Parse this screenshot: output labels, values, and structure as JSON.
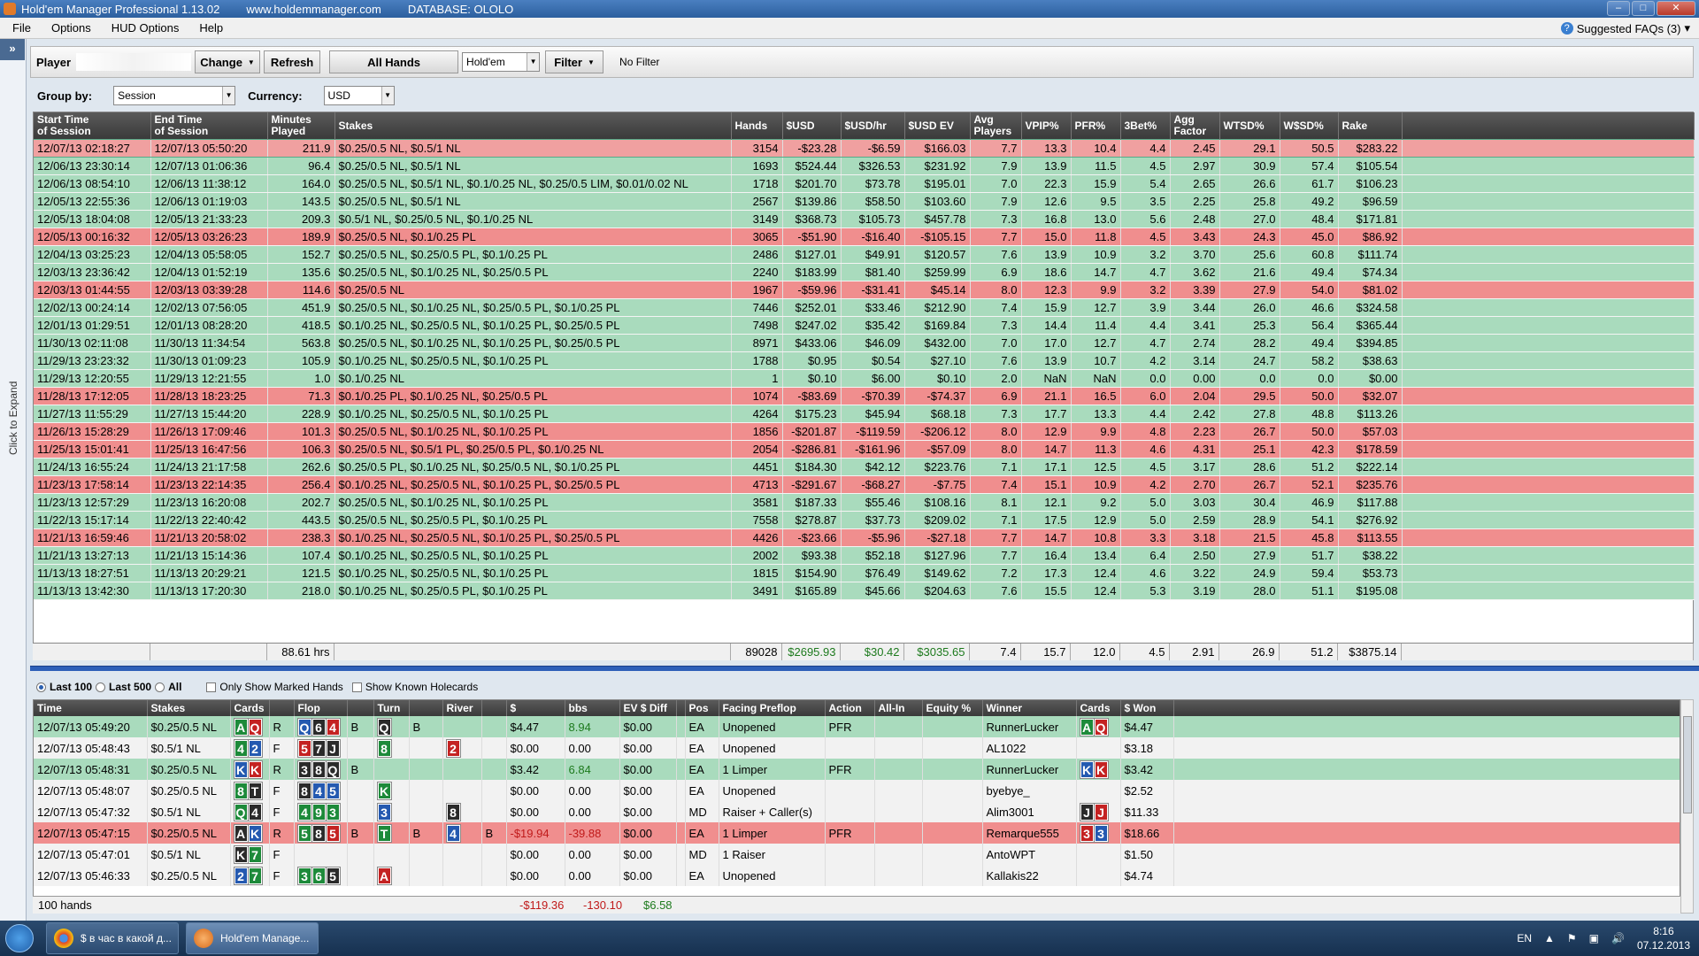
{
  "window": {
    "title": "Hold'em Manager Professional 1.13.02",
    "url": "www.holdemmanager.com",
    "database": "DATABASE: OLOLO"
  },
  "menu": {
    "items": [
      "File",
      "Options",
      "HUD Options",
      "Help"
    ],
    "faq": "Suggested FAQs (3)"
  },
  "sidebar": {
    "expand_label": "Click to Expand",
    "expand_glyph": "»"
  },
  "filterbar": {
    "player_label": "Player",
    "change": "Change",
    "refresh": "Refresh",
    "all_hands": "All Hands",
    "game": "Hold'em",
    "filter": "Filter",
    "no_filter": "No Filter"
  },
  "groupbar": {
    "group_label": "Group by:",
    "group_value": "Session",
    "currency_label": "Currency:",
    "currency_value": "USD"
  },
  "sessions": {
    "columns": [
      "Start Time\nof Session",
      "End Time\nof Session",
      "Minutes\nPlayed",
      "Stakes",
      "Hands",
      "$USD",
      "$USD/hr",
      "$USD EV",
      "Avg\nPlayers",
      "VPIP%",
      "PFR%",
      "3Bet%",
      "Agg\nFactor",
      "WTSD%",
      "W$SD%",
      "Rake"
    ],
    "rows": [
      [
        "12/07/13 02:18:27",
        "12/07/13 05:50:20",
        "211.9",
        "$0.25/0.5 NL, $0.5/1 NL",
        "3154",
        "-$23.28",
        "-$6.59",
        "$166.03",
        "7.7",
        "13.3",
        "10.4",
        "4.4",
        "2.45",
        "29.1",
        "50.5",
        "$283.22",
        "first"
      ],
      [
        "12/06/13 23:30:14",
        "12/07/13 01:06:36",
        "96.4",
        "$0.25/0.5 NL, $0.5/1 NL",
        "1693",
        "$524.44",
        "$326.53",
        "$231.92",
        "7.9",
        "13.9",
        "11.5",
        "4.5",
        "2.97",
        "30.9",
        "57.4",
        "$105.54",
        "win"
      ],
      [
        "12/06/13 08:54:10",
        "12/06/13 11:38:12",
        "164.0",
        "$0.25/0.5 NL, $0.5/1 NL, $0.1/0.25 NL, $0.25/0.5 LIM, $0.01/0.02 NL",
        "1718",
        "$201.70",
        "$73.78",
        "$195.01",
        "7.0",
        "22.3",
        "15.9",
        "5.4",
        "2.65",
        "26.6",
        "61.7",
        "$106.23",
        "win"
      ],
      [
        "12/05/13 22:55:36",
        "12/06/13 01:19:03",
        "143.5",
        "$0.25/0.5 NL, $0.5/1 NL",
        "2567",
        "$139.86",
        "$58.50",
        "$103.60",
        "7.9",
        "12.6",
        "9.5",
        "3.5",
        "2.25",
        "25.8",
        "49.2",
        "$96.59",
        "win"
      ],
      [
        "12/05/13 18:04:08",
        "12/05/13 21:33:23",
        "209.3",
        "$0.5/1 NL, $0.25/0.5 NL, $0.1/0.25 NL",
        "3149",
        "$368.73",
        "$105.73",
        "$457.78",
        "7.3",
        "16.8",
        "13.0",
        "5.6",
        "2.48",
        "27.0",
        "48.4",
        "$171.81",
        "win"
      ],
      [
        "12/05/13 00:16:32",
        "12/05/13 03:26:23",
        "189.9",
        "$0.25/0.5 NL, $0.1/0.25 PL",
        "3065",
        "-$51.90",
        "-$16.40",
        "-$105.15",
        "7.7",
        "15.0",
        "11.8",
        "4.5",
        "3.43",
        "24.3",
        "45.0",
        "$86.92",
        "loss"
      ],
      [
        "12/04/13 03:25:23",
        "12/04/13 05:58:05",
        "152.7",
        "$0.25/0.5 NL, $0.25/0.5 PL, $0.1/0.25 PL",
        "2486",
        "$127.01",
        "$49.91",
        "$120.57",
        "7.6",
        "13.9",
        "10.9",
        "3.2",
        "3.70",
        "25.6",
        "60.8",
        "$111.74",
        "win"
      ],
      [
        "12/03/13 23:36:42",
        "12/04/13 01:52:19",
        "135.6",
        "$0.25/0.5 NL, $0.1/0.25 NL, $0.25/0.5 PL",
        "2240",
        "$183.99",
        "$81.40",
        "$259.99",
        "6.9",
        "18.6",
        "14.7",
        "4.7",
        "3.62",
        "21.6",
        "49.4",
        "$74.34",
        "win"
      ],
      [
        "12/03/13 01:44:55",
        "12/03/13 03:39:28",
        "114.6",
        "$0.25/0.5 NL",
        "1967",
        "-$59.96",
        "-$31.41",
        "$45.14",
        "8.0",
        "12.3",
        "9.9",
        "3.2",
        "3.39",
        "27.9",
        "54.0",
        "$81.02",
        "loss"
      ],
      [
        "12/02/13 00:24:14",
        "12/02/13 07:56:05",
        "451.9",
        "$0.25/0.5 NL, $0.1/0.25 NL, $0.25/0.5 PL, $0.1/0.25 PL",
        "7446",
        "$252.01",
        "$33.46",
        "$212.90",
        "7.4",
        "15.9",
        "12.7",
        "3.9",
        "3.44",
        "26.0",
        "46.6",
        "$324.58",
        "win"
      ],
      [
        "12/01/13 01:29:51",
        "12/01/13 08:28:20",
        "418.5",
        "$0.1/0.25 NL, $0.25/0.5 NL, $0.1/0.25 PL, $0.25/0.5 PL",
        "7498",
        "$247.02",
        "$35.42",
        "$169.84",
        "7.3",
        "14.4",
        "11.4",
        "4.4",
        "3.41",
        "25.3",
        "56.4",
        "$365.44",
        "win"
      ],
      [
        "11/30/13 02:11:08",
        "11/30/13 11:34:54",
        "563.8",
        "$0.25/0.5 NL, $0.1/0.25 NL, $0.1/0.25 PL, $0.25/0.5 PL",
        "8971",
        "$433.06",
        "$46.09",
        "$432.00",
        "7.0",
        "17.0",
        "12.7",
        "4.7",
        "2.74",
        "28.2",
        "49.4",
        "$394.85",
        "win"
      ],
      [
        "11/29/13 23:23:32",
        "11/30/13 01:09:23",
        "105.9",
        "$0.1/0.25 NL, $0.25/0.5 NL, $0.1/0.25 PL",
        "1788",
        "$0.95",
        "$0.54",
        "$27.10",
        "7.6",
        "13.9",
        "10.7",
        "4.2",
        "3.14",
        "24.7",
        "58.2",
        "$38.63",
        "win"
      ],
      [
        "11/29/13 12:20:55",
        "11/29/13 12:21:55",
        "1.0",
        "$0.1/0.25 NL",
        "1",
        "$0.10",
        "$6.00",
        "$0.10",
        "2.0",
        "NaN",
        "NaN",
        "0.0",
        "0.00",
        "0.0",
        "0.0",
        "$0.00",
        "win"
      ],
      [
        "11/28/13 17:12:05",
        "11/28/13 18:23:25",
        "71.3",
        "$0.1/0.25 PL, $0.1/0.25 NL, $0.25/0.5 PL",
        "1074",
        "-$83.69",
        "-$70.39",
        "-$74.37",
        "6.9",
        "21.1",
        "16.5",
        "6.0",
        "2.04",
        "29.5",
        "50.0",
        "$32.07",
        "loss"
      ],
      [
        "11/27/13 11:55:29",
        "11/27/13 15:44:20",
        "228.9",
        "$0.1/0.25 NL, $0.25/0.5 NL, $0.1/0.25 PL",
        "4264",
        "$175.23",
        "$45.94",
        "$68.18",
        "7.3",
        "17.7",
        "13.3",
        "4.4",
        "2.42",
        "27.8",
        "48.8",
        "$113.26",
        "win"
      ],
      [
        "11/26/13 15:28:29",
        "11/26/13 17:09:46",
        "101.3",
        "$0.25/0.5 NL, $0.1/0.25 NL, $0.1/0.25 PL",
        "1856",
        "-$201.87",
        "-$119.59",
        "-$206.12",
        "8.0",
        "12.9",
        "9.9",
        "4.8",
        "2.23",
        "26.7",
        "50.0",
        "$57.03",
        "loss"
      ],
      [
        "11/25/13 15:01:41",
        "11/25/13 16:47:56",
        "106.3",
        "$0.25/0.5 NL, $0.5/1 PL, $0.25/0.5 PL, $0.1/0.25 NL",
        "2054",
        "-$286.81",
        "-$161.96",
        "-$57.09",
        "8.0",
        "14.7",
        "11.3",
        "4.6",
        "4.31",
        "25.1",
        "42.3",
        "$178.59",
        "loss"
      ],
      [
        "11/24/13 16:55:24",
        "11/24/13 21:17:58",
        "262.6",
        "$0.25/0.5 PL, $0.1/0.25 NL, $0.25/0.5 NL, $0.1/0.25 PL",
        "4451",
        "$184.30",
        "$42.12",
        "$223.76",
        "7.1",
        "17.1",
        "12.5",
        "4.5",
        "3.17",
        "28.6",
        "51.2",
        "$222.14",
        "win"
      ],
      [
        "11/23/13 17:58:14",
        "11/23/13 22:14:35",
        "256.4",
        "$0.1/0.25 NL, $0.25/0.5 NL, $0.1/0.25 PL, $0.25/0.5 PL",
        "4713",
        "-$291.67",
        "-$68.27",
        "-$7.75",
        "7.4",
        "15.1",
        "10.9",
        "4.2",
        "2.70",
        "26.7",
        "52.1",
        "$235.76",
        "loss"
      ],
      [
        "11/23/13 12:57:29",
        "11/23/13 16:20:08",
        "202.7",
        "$0.25/0.5 NL, $0.1/0.25 NL, $0.1/0.25 PL",
        "3581",
        "$187.33",
        "$55.46",
        "$108.16",
        "8.1",
        "12.1",
        "9.2",
        "5.0",
        "3.03",
        "30.4",
        "46.9",
        "$117.88",
        "win"
      ],
      [
        "11/22/13 15:17:14",
        "11/22/13 22:40:42",
        "443.5",
        "$0.25/0.5 NL, $0.25/0.5 PL, $0.1/0.25 PL",
        "7558",
        "$278.87",
        "$37.73",
        "$209.02",
        "7.1",
        "17.5",
        "12.9",
        "5.0",
        "2.59",
        "28.9",
        "54.1",
        "$276.92",
        "win"
      ],
      [
        "11/21/13 16:59:46",
        "11/21/13 20:58:02",
        "238.3",
        "$0.1/0.25 NL, $0.25/0.5 NL, $0.1/0.25 PL, $0.25/0.5 PL",
        "4426",
        "-$23.66",
        "-$5.96",
        "-$27.18",
        "7.7",
        "14.7",
        "10.8",
        "3.3",
        "3.18",
        "21.5",
        "45.8",
        "$113.55",
        "loss"
      ],
      [
        "11/21/13 13:27:13",
        "11/21/13 15:14:36",
        "107.4",
        "$0.1/0.25 NL, $0.25/0.5 NL, $0.1/0.25 PL",
        "2002",
        "$93.38",
        "$52.18",
        "$127.96",
        "7.7",
        "16.4",
        "13.4",
        "6.4",
        "2.50",
        "27.9",
        "51.7",
        "$38.22",
        "win"
      ],
      [
        "11/13/13 18:27:51",
        "11/13/13 20:29:21",
        "121.5",
        "$0.1/0.25 NL, $0.25/0.5 NL, $0.1/0.25 PL",
        "1815",
        "$154.90",
        "$76.49",
        "$149.62",
        "7.2",
        "17.3",
        "12.4",
        "4.6",
        "3.22",
        "24.9",
        "59.4",
        "$53.73",
        "win"
      ],
      [
        "11/13/13 13:42:30",
        "11/13/13 17:20:30",
        "218.0",
        "$0.1/0.25 NL, $0.25/0.5 PL, $0.1/0.25 PL",
        "3491",
        "$165.89",
        "$45.66",
        "$204.63",
        "7.6",
        "15.5",
        "12.4",
        "5.3",
        "3.19",
        "28.0",
        "51.1",
        "$195.08",
        "win"
      ]
    ],
    "totals": [
      "",
      "",
      "88.61 hrs",
      "",
      "89028",
      "$2695.93",
      "$30.42",
      "$3035.65",
      "7.4",
      "15.7",
      "12.0",
      "4.5",
      "2.91",
      "26.9",
      "51.2",
      "$3875.14"
    ]
  },
  "hand_controls": {
    "last100": "Last 100",
    "last500": "Last 500",
    "all": "All",
    "only_marked": "Only Show Marked Hands",
    "show_known": "Show Known Holecards"
  },
  "hands": {
    "columns": [
      "Time",
      "Stakes",
      "Cards",
      "",
      "Flop",
      "",
      "Turn",
      "",
      "River",
      "",
      "$",
      "bbs",
      "EV $ Diff",
      "",
      "Pos",
      "Facing Preflop",
      "Action",
      "All-In",
      "Equity %",
      "Winner",
      "Cards",
      "$ Won"
    ],
    "rows": [
      {
        "style": "win",
        "time": "12/07/13 05:49:20",
        "stakes": "$0.25/0.5 NL",
        "cards": [
          [
            "A",
            "c"
          ],
          [
            "Q",
            "h"
          ]
        ],
        "pre": "R",
        "flop": [
          [
            "Q",
            "d"
          ],
          [
            "6",
            "s"
          ],
          [
            "4",
            "h"
          ]
        ],
        "flop_act": "B",
        "turn": [
          [
            "Q",
            "s"
          ]
        ],
        "turn_act": "B",
        "river": [],
        "river_act": "",
        "usd": "$4.47",
        "bbs": "8.94",
        "ev": "$0.00",
        "pos": "EA",
        "facing": "Unopened",
        "action": "PFR",
        "allin": "",
        "equity": "",
        "winner": "RunnerLucker",
        "wcards": [
          [
            "A",
            "c"
          ],
          [
            "Q",
            "h"
          ]
        ],
        "won": "$4.47"
      },
      {
        "style": "plain",
        "time": "12/07/13 05:48:43",
        "stakes": "$0.5/1 NL",
        "cards": [
          [
            "4",
            "c"
          ],
          [
            "2",
            "d"
          ]
        ],
        "pre": "F",
        "flop": [
          [
            "5",
            "h"
          ],
          [
            "7",
            "s"
          ],
          [
            "J",
            "s"
          ]
        ],
        "flop_act": "",
        "turn": [
          [
            "8",
            "c"
          ]
        ],
        "turn_act": "",
        "river": [
          [
            "2",
            "h"
          ]
        ],
        "river_act": "",
        "usd": "$0.00",
        "bbs": "0.00",
        "ev": "$0.00",
        "pos": "EA",
        "facing": "Unopened",
        "action": "",
        "allin": "",
        "equity": "",
        "winner": "AL1022",
        "wcards": [],
        "won": "$3.18"
      },
      {
        "style": "win",
        "time": "12/07/13 05:48:31",
        "stakes": "$0.25/0.5 NL",
        "cards": [
          [
            "K",
            "d"
          ],
          [
            "K",
            "h"
          ]
        ],
        "pre": "R",
        "flop": [
          [
            "3",
            "s"
          ],
          [
            "8",
            "s"
          ],
          [
            "Q",
            "s"
          ]
        ],
        "flop_act": "B",
        "turn": [],
        "turn_act": "",
        "river": [],
        "river_act": "",
        "usd": "$3.42",
        "bbs": "6.84",
        "ev": "$0.00",
        "pos": "EA",
        "facing": "1 Limper",
        "action": "PFR",
        "allin": "",
        "equity": "",
        "winner": "RunnerLucker",
        "wcards": [
          [
            "K",
            "d"
          ],
          [
            "K",
            "h"
          ]
        ],
        "won": "$3.42"
      },
      {
        "style": "plain",
        "time": "12/07/13 05:48:07",
        "stakes": "$0.25/0.5 NL",
        "cards": [
          [
            "8",
            "c"
          ],
          [
            "T",
            "s"
          ]
        ],
        "pre": "F",
        "flop": [
          [
            "8",
            "s"
          ],
          [
            "4",
            "d"
          ],
          [
            "5",
            "d"
          ]
        ],
        "flop_act": "",
        "turn": [
          [
            "K",
            "c"
          ]
        ],
        "turn_act": "",
        "river": [],
        "river_act": "",
        "usd": "$0.00",
        "bbs": "0.00",
        "ev": "$0.00",
        "pos": "EA",
        "facing": "Unopened",
        "action": "",
        "allin": "",
        "equity": "",
        "winner": "byebye_",
        "wcards": [],
        "won": "$2.52"
      },
      {
        "style": "plain",
        "time": "12/07/13 05:47:32",
        "stakes": "$0.5/1 NL",
        "cards": [
          [
            "Q",
            "c"
          ],
          [
            "4",
            "s"
          ]
        ],
        "pre": "F",
        "flop": [
          [
            "4",
            "c"
          ],
          [
            "9",
            "c"
          ],
          [
            "3",
            "c"
          ]
        ],
        "flop_act": "",
        "turn": [
          [
            "3",
            "d"
          ]
        ],
        "turn_act": "",
        "river": [
          [
            "8",
            "s"
          ]
        ],
        "river_act": "",
        "usd": "$0.00",
        "bbs": "0.00",
        "ev": "$0.00",
        "pos": "MD",
        "facing": "Raiser + Caller(s)",
        "action": "",
        "allin": "",
        "equity": "",
        "winner": "Alim3001",
        "wcards": [
          [
            "J",
            "s"
          ],
          [
            "J",
            "h"
          ]
        ],
        "won": "$11.33"
      },
      {
        "style": "loss",
        "time": "12/07/13 05:47:15",
        "stakes": "$0.25/0.5 NL",
        "cards": [
          [
            "A",
            "s"
          ],
          [
            "K",
            "d"
          ]
        ],
        "pre": "R",
        "flop": [
          [
            "5",
            "c"
          ],
          [
            "8",
            "s"
          ],
          [
            "5",
            "h"
          ]
        ],
        "flop_act": "B",
        "turn": [
          [
            "T",
            "c"
          ]
        ],
        "turn_act": "B",
        "river": [
          [
            "4",
            "d"
          ]
        ],
        "river_act": "B",
        "usd": "-$19.94",
        "bbs": "-39.88",
        "ev": "$0.00",
        "pos": "EA",
        "facing": "1 Limper",
        "action": "PFR",
        "allin": "",
        "equity": "",
        "winner": "Remarque555",
        "wcards": [
          [
            "3",
            "h"
          ],
          [
            "3",
            "d"
          ]
        ],
        "won": "$18.66"
      },
      {
        "style": "plain",
        "time": "12/07/13 05:47:01",
        "stakes": "$0.5/1 NL",
        "cards": [
          [
            "K",
            "s"
          ],
          [
            "7",
            "c"
          ]
        ],
        "pre": "F",
        "flop": [],
        "flop_act": "",
        "turn": [],
        "turn_act": "",
        "river": [],
        "river_act": "",
        "usd": "$0.00",
        "bbs": "0.00",
        "ev": "$0.00",
        "pos": "MD",
        "facing": "1 Raiser",
        "action": "",
        "allin": "",
        "equity": "",
        "winner": "AntoWPT",
        "wcards": [],
        "won": "$1.50"
      },
      {
        "style": "plain",
        "time": "12/07/13 05:46:33",
        "stakes": "$0.25/0.5 NL",
        "cards": [
          [
            "2",
            "d"
          ],
          [
            "7",
            "c"
          ]
        ],
        "pre": "F",
        "flop": [
          [
            "3",
            "c"
          ],
          [
            "6",
            "c"
          ],
          [
            "5",
            "s"
          ]
        ],
        "flop_act": "",
        "turn": [
          [
            "A",
            "h"
          ]
        ],
        "turn_act": "",
        "river": [],
        "river_act": "",
        "usd": "$0.00",
        "bbs": "0.00",
        "ev": "$0.00",
        "pos": "EA",
        "facing": "Unopened",
        "action": "",
        "allin": "",
        "equity": "",
        "winner": "Kallakis22",
        "wcards": [],
        "won": "$4.74"
      }
    ],
    "footer": {
      "count": "100 hands",
      "usd": "-$119.36",
      "bbs": "-130.10",
      "ev": "$6.58"
    }
  },
  "taskbar": {
    "tasks": [
      "$ в час в какой д...",
      "Hold'em Manage..."
    ],
    "lang": "EN",
    "time": "8:16",
    "date": "07.12.2013"
  },
  "colors": {
    "win_row": "#a9dbbd",
    "loss_row": "#f08e8e",
    "header": "#4a4a4a",
    "splitter": "#2d5fb8"
  }
}
